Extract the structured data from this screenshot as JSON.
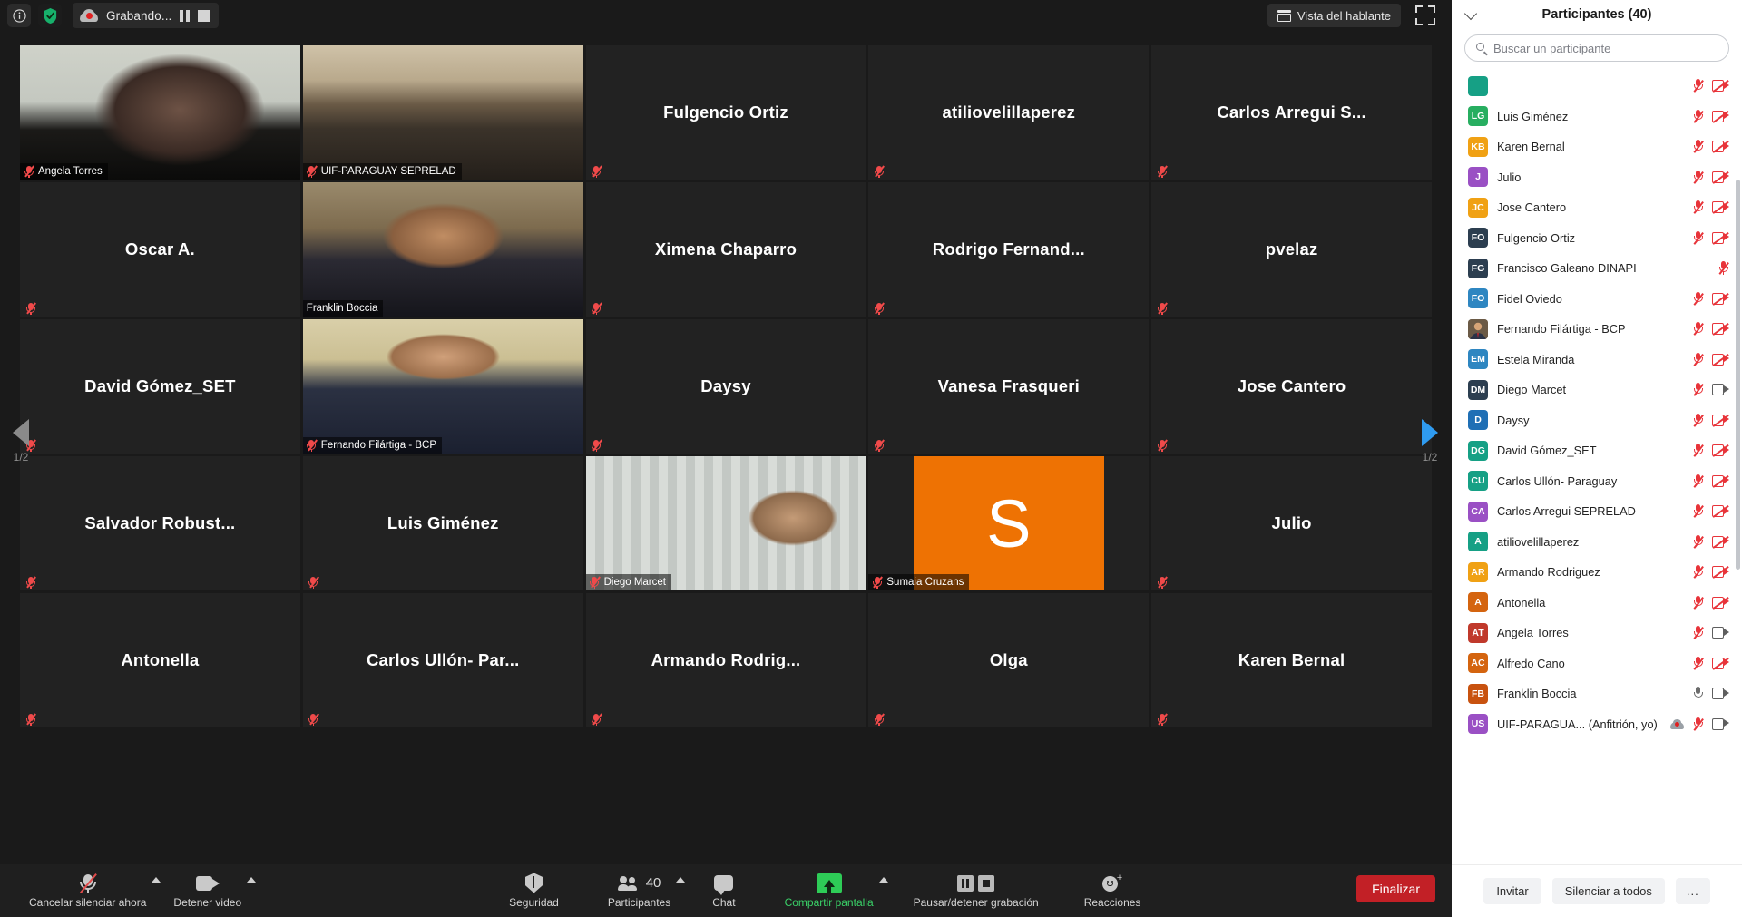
{
  "topbar": {
    "info_icon": "info-icon",
    "shield_icon": "security-shield-icon",
    "recording_label": "Grabando...",
    "pause_recording_icon": "pause-icon",
    "stop_recording_icon": "stop-icon",
    "view_button_label": "Vista del hablante",
    "view_button_icon": "grid-view-icon",
    "fullscreen_icon": "fullscreen-icon"
  },
  "pager": {
    "left_label": "1/2",
    "right_label": "1/2",
    "left_icon": "chevron-left-icon",
    "right_icon": "chevron-right-icon"
  },
  "tiles": [
    {
      "name": "Angela Torres",
      "type": "video",
      "badge": "Angela Torres",
      "muted": true,
      "active": false,
      "video": "woman-dark-hair-office"
    },
    {
      "name": "UIF-PARAGUAY SEPRELAD",
      "type": "video",
      "badge": "UIF-PARAGUAY SEPRELAD",
      "muted": true,
      "active": false,
      "video": "conference-room"
    },
    {
      "name": "Fulgencio Ortiz",
      "type": "name",
      "badge": "",
      "muted": true,
      "active": false
    },
    {
      "name": "atiliovelillaperez",
      "type": "name",
      "badge": "",
      "muted": true,
      "active": false
    },
    {
      "name": "Carlos Arregui S...",
      "type": "name",
      "badge": "",
      "muted": true,
      "active": false
    },
    {
      "name": "Oscar A.",
      "type": "name",
      "badge": "",
      "muted": true,
      "active": false
    },
    {
      "name": "Franklin Boccia",
      "type": "video",
      "badge": "Franklin Boccia",
      "muted": false,
      "active": true,
      "video": "man-speaking-painting-bg"
    },
    {
      "name": "Ximena Chaparro",
      "type": "name",
      "badge": "",
      "muted": true,
      "active": false
    },
    {
      "name": "Rodrigo  Fernand...",
      "type": "name",
      "badge": "",
      "muted": true,
      "active": false
    },
    {
      "name": "pvelaz",
      "type": "name",
      "badge": "",
      "muted": true,
      "active": false
    },
    {
      "name": "David Gómez_SET",
      "type": "name",
      "badge": "",
      "muted": true,
      "active": false
    },
    {
      "name": "Fernando Filártiga - BCP",
      "type": "video",
      "badge": "Fernando Filártiga - BCP",
      "muted": true,
      "active": false,
      "video": "man-suit-red-tie"
    },
    {
      "name": "Daysy",
      "type": "name",
      "badge": "",
      "muted": true,
      "active": false
    },
    {
      "name": "Vanesa Frasqueri",
      "type": "name",
      "badge": "",
      "muted": true,
      "active": false
    },
    {
      "name": "Jose Cantero",
      "type": "name",
      "badge": "",
      "muted": true,
      "active": false
    },
    {
      "name": "Salvador  Robust...",
      "type": "name",
      "badge": "",
      "muted": true,
      "active": false
    },
    {
      "name": "Luis Giménez",
      "type": "name",
      "badge": "",
      "muted": true,
      "active": false
    },
    {
      "name": "Diego Marcet",
      "type": "video",
      "badge": "Diego Marcet",
      "muted": true,
      "active": false,
      "video": "man-suit-blinds-bg"
    },
    {
      "name": "Sumaia Cruzans",
      "type": "letter",
      "letter": "S",
      "color": "#ee7203",
      "badge": "Sumaia Cruzans",
      "muted": true,
      "active": false
    },
    {
      "name": "Julio",
      "type": "name",
      "badge": "",
      "muted": true,
      "active": false
    },
    {
      "name": "Antonella",
      "type": "name",
      "badge": "",
      "muted": true,
      "active": false
    },
    {
      "name": "Carlos Ullón- Par...",
      "type": "name",
      "badge": "",
      "muted": true,
      "active": false
    },
    {
      "name": "Armando  Rodrig...",
      "type": "name",
      "badge": "",
      "muted": true,
      "active": false
    },
    {
      "name": "Olga",
      "type": "name",
      "badge": "",
      "muted": true,
      "active": false
    },
    {
      "name": "Karen Bernal",
      "type": "name",
      "badge": "",
      "muted": true,
      "active": false
    }
  ],
  "toolbar": {
    "mute_label": "Cancelar silenciar ahora",
    "mute_icon": "microphone-muted-icon",
    "video_label": "Detener video",
    "video_icon": "camera-icon",
    "security_label": "Seguridad",
    "security_icon": "shield-icon",
    "participants_label": "Participantes",
    "participants_count": "40",
    "participants_icon": "people-icon",
    "chat_label": "Chat",
    "chat_icon": "chat-bubble-icon",
    "share_label": "Compartir pantalla",
    "share_icon": "share-screen-icon",
    "record_label": "Pausar/detener grabación",
    "record_pause_icon": "pause-icon",
    "record_stop_icon": "stop-icon",
    "reactions_label": "Reacciones",
    "reactions_icon": "smiley-plus-icon",
    "end_label": "Finalizar",
    "accent_green": "#3ad168",
    "end_red": "#c22026"
  },
  "panel": {
    "collapse_icon": "chevron-down-icon",
    "title": "Participantes (40)",
    "search_placeholder": "Buscar un participante",
    "search_value": "",
    "search_icon": "search-icon",
    "footer": {
      "invite_label": "Invitar",
      "mute_all_label": "Silenciar a todos",
      "more_label": "..."
    },
    "participants": [
      {
        "initials": "US",
        "color": "#9a50c4",
        "name": "UIF-PARAGUA... (Anfitrión, yo)",
        "recording": true,
        "mic": "muted",
        "cam": "on"
      },
      {
        "initials": "FB",
        "color": "#c8520f",
        "name": "Franklin Boccia",
        "recording": false,
        "mic": "on",
        "cam": "on"
      },
      {
        "initials": "AC",
        "color": "#d4640f",
        "name": "Alfredo Cano",
        "recording": false,
        "mic": "muted",
        "cam": "off"
      },
      {
        "initials": "AT",
        "color": "#c0392b",
        "name": "Angela Torres",
        "recording": false,
        "mic": "muted",
        "cam": "on"
      },
      {
        "initials": "A",
        "color": "#d4640f",
        "name": "Antonella",
        "recording": false,
        "mic": "muted",
        "cam": "off"
      },
      {
        "initials": "AR",
        "color": "#f0a114",
        "name": "Armando Rodriguez",
        "recording": false,
        "mic": "muted",
        "cam": "off"
      },
      {
        "initials": "A",
        "color": "#16a085",
        "name": "atiliovelillaperez",
        "recording": false,
        "mic": "muted",
        "cam": "off"
      },
      {
        "initials": "CA",
        "color": "#9a50c4",
        "name": "Carlos Arregui SEPRELAD",
        "recording": false,
        "mic": "muted",
        "cam": "off"
      },
      {
        "initials": "CU",
        "color": "#16a085",
        "name": "Carlos Ullón- Paraguay",
        "recording": false,
        "mic": "muted",
        "cam": "off"
      },
      {
        "initials": "DG",
        "color": "#16a085",
        "name": "David Gómez_SET",
        "recording": false,
        "mic": "muted",
        "cam": "off"
      },
      {
        "initials": "D",
        "color": "#1f6fb5",
        "name": "Daysy",
        "recording": false,
        "mic": "muted",
        "cam": "off"
      },
      {
        "initials": "DM",
        "color": "#2c3e50",
        "name": "Diego Marcet",
        "recording": false,
        "mic": "muted",
        "cam": "on"
      },
      {
        "initials": "EM",
        "color": "#2e86c1",
        "name": "Estela Miranda",
        "recording": false,
        "mic": "muted",
        "cam": "off"
      },
      {
        "initials": "",
        "color": "#7b6a55",
        "name": "Fernando Filártiga - BCP",
        "recording": false,
        "mic": "muted",
        "cam": "off",
        "photo": true
      },
      {
        "initials": "FO",
        "color": "#2e86c1",
        "name": "Fidel Oviedo",
        "recording": false,
        "mic": "muted",
        "cam": "off"
      },
      {
        "initials": "FG",
        "color": "#2c3e50",
        "name": "Francisco Galeano DINAPI",
        "recording": false,
        "mic": "muted",
        "cam": "none"
      },
      {
        "initials": "FO",
        "color": "#2c3e50",
        "name": "Fulgencio Ortiz",
        "recording": false,
        "mic": "muted",
        "cam": "off"
      },
      {
        "initials": "JC",
        "color": "#f0a114",
        "name": "Jose Cantero",
        "recording": false,
        "mic": "muted",
        "cam": "off"
      },
      {
        "initials": "J",
        "color": "#9a50c4",
        "name": "Julio",
        "recording": false,
        "mic": "muted",
        "cam": "off"
      },
      {
        "initials": "KB",
        "color": "#f0a114",
        "name": "Karen Bernal",
        "recording": false,
        "mic": "muted",
        "cam": "off"
      },
      {
        "initials": "LG",
        "color": "#27ae60",
        "name": "Luis Giménez",
        "recording": false,
        "mic": "muted",
        "cam": "off"
      },
      {
        "initials": "",
        "color": "#16a085",
        "name": "",
        "recording": false,
        "mic": "muted",
        "cam": "off"
      }
    ]
  }
}
